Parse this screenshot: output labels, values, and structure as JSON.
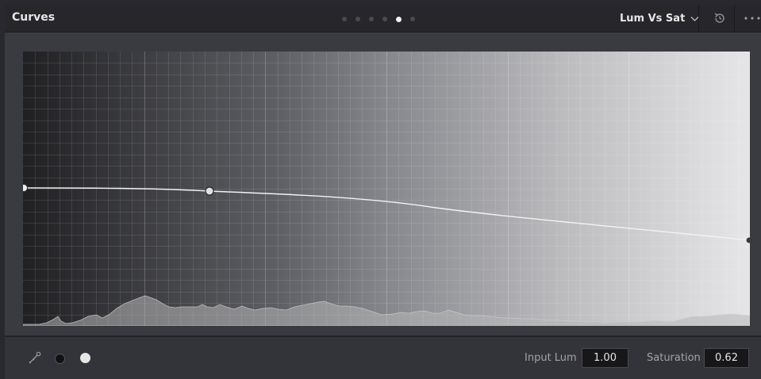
{
  "header": {
    "title": "Curves",
    "pager": {
      "count": 6,
      "active_index": 4
    },
    "mode": "Lum Vs Sat",
    "mode_icon": "chevron-down-icon",
    "reset_icon": "reset-icon",
    "more_icon": "more-icon"
  },
  "footer": {
    "picker_icon": "eyedropper-icon",
    "input_lum_label": "Input Lum",
    "input_lum_value": "1.00",
    "saturation_label": "Saturation",
    "saturation_value": "0.62"
  },
  "colors": {
    "accent": "#e6e6e6",
    "curve": "#f2f2f2",
    "histogram": "#b7b7b7"
  }
}
